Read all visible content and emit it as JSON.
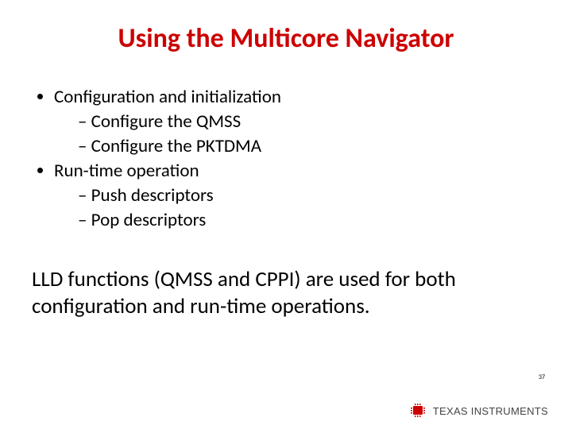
{
  "title": "Using the Multicore Navigator",
  "bullets": {
    "b1": "Configuration and initialization",
    "b1a": "– Configure the QMSS",
    "b1b": "– Configure the PKTDMA",
    "b2": "Run-time operation",
    "b2a": "– Push descriptors",
    "b2b": "– Pop descriptors"
  },
  "summary": "LLD functions (QMSS and CPPI) are used for both configuration and run-time operations.",
  "page_number": "37",
  "logo": {
    "text": "TEXAS INSTRUMENTS"
  }
}
